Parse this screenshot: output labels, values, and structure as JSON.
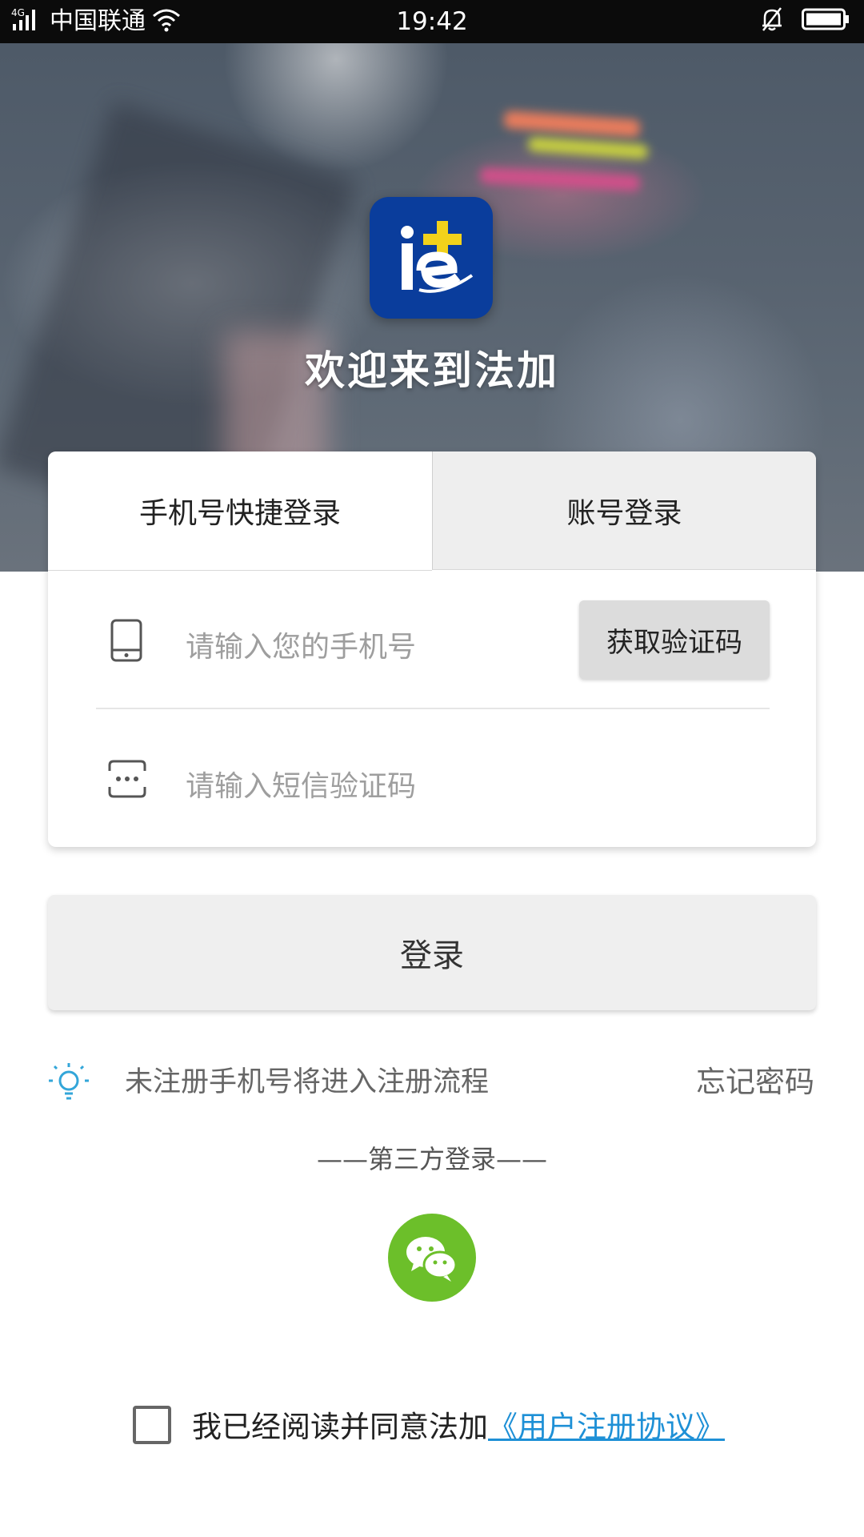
{
  "status_bar": {
    "network": "4G",
    "carrier": "中国联通",
    "time": "19:42"
  },
  "hero": {
    "welcome": "欢迎来到法加"
  },
  "tabs": [
    {
      "label": "手机号快捷登录",
      "active": true
    },
    {
      "label": "账号登录",
      "active": false
    }
  ],
  "form": {
    "phone_placeholder": "请输入您的手机号",
    "get_code_label": "获取验证码",
    "sms_placeholder": "请输入短信验证码"
  },
  "login_button": "登录",
  "tip": {
    "text": "未注册手机号将进入注册流程",
    "forgot": "忘记密码"
  },
  "third_party": {
    "title": "——第三方登录——"
  },
  "agreement": {
    "text": "我已经阅读并同意法加",
    "link": "《用户注册协议》",
    "checked": false
  },
  "colors": {
    "brand_blue": "#0a3d9c",
    "wechat_green": "#6cbf2a",
    "link_blue": "#1e90d6",
    "tip_icon": "#33a6d9"
  },
  "icons": [
    "signal-icon",
    "wifi-icon",
    "bell-muted-icon",
    "battery-icon",
    "phone-icon",
    "sms-code-icon",
    "lightbulb-icon",
    "wechat-icon"
  ]
}
